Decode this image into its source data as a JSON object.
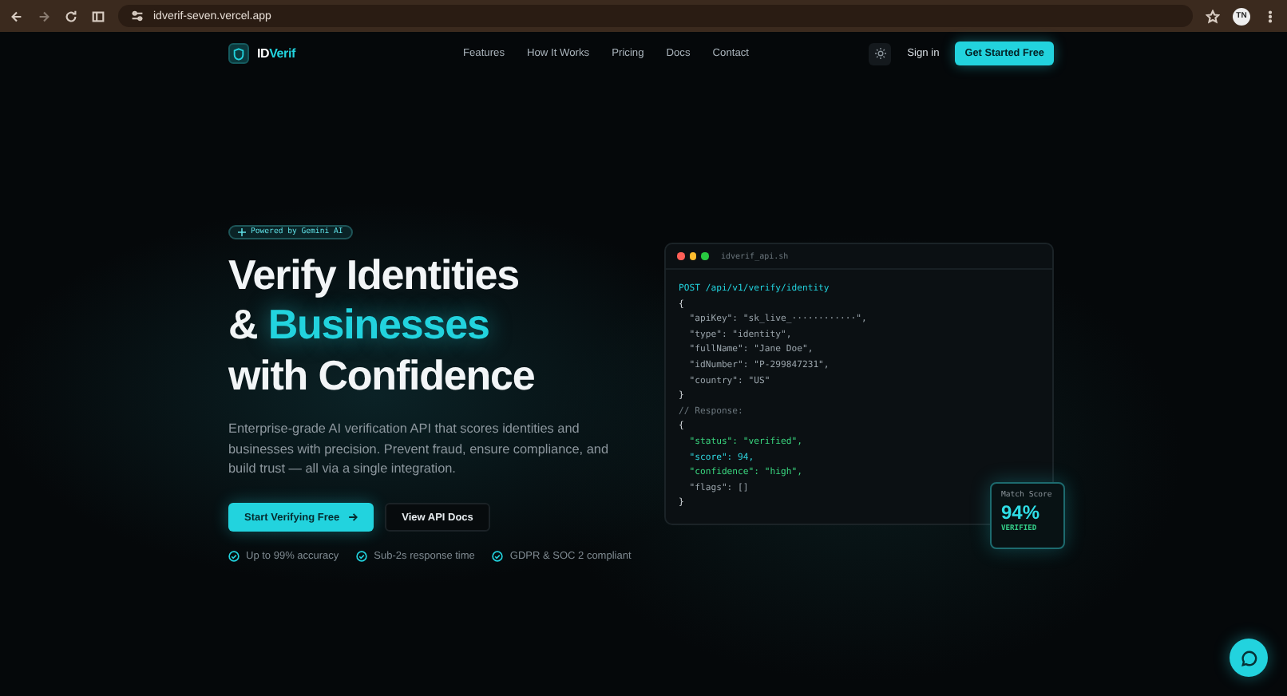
{
  "browser": {
    "url": "idverif-seven.vercel.app",
    "profile": "TN"
  },
  "nav": {
    "brand_prefix": "ID",
    "brand_suffix": "Verif",
    "links": [
      {
        "label": "Features"
      },
      {
        "label": "How It Works"
      },
      {
        "label": "Pricing"
      },
      {
        "label": "Docs"
      },
      {
        "label": "Contact"
      }
    ],
    "sign_in": "Sign in",
    "cta": "Get Started Free"
  },
  "hero": {
    "badge": "Powered by Gemini AI",
    "title_lines": [
      "Verify Identities",
      "& **Businesses**",
      "with Confidence"
    ],
    "description": "Enterprise-grade AI verification API that scores identities and businesses with precision. Prevent fraud, ensure compliance, and build trust — all via a single integration.",
    "primary_button": "Start Verifying Free",
    "secondary_button": "View API Docs",
    "features": [
      "Up to 99% accuracy",
      "Sub-2s response time",
      "GDPR & SOC 2 compliant"
    ]
  },
  "code_window": {
    "filename": "idverif_api.sh",
    "lines": [
      {
        "text": "POST /api/v1/verify/identity",
        "kind": "method"
      },
      {
        "text": "{",
        "kind": "brace"
      },
      {
        "text": "  \"apiKey\": \"sk_live_············\",",
        "kind": "field"
      },
      {
        "text": "  \"type\": \"identity\",",
        "kind": "field"
      },
      {
        "text": "  \"fullName\": \"Jane Doe\",",
        "kind": "field"
      },
      {
        "text": "  \"idNumber\": \"P-299847231\",",
        "kind": "field"
      },
      {
        "text": "  \"country\": \"US\"",
        "kind": "field"
      },
      {
        "text": "}",
        "kind": "brace"
      },
      {
        "text": "// Response:",
        "kind": "comment"
      },
      {
        "text": "{",
        "kind": "brace"
      },
      {
        "text": "  \"status\": \"verified\",",
        "kind": "success"
      },
      {
        "text": "  \"score\": 94,",
        "kind": "accent"
      },
      {
        "text": "  \"confidence\": \"high\",",
        "kind": "success"
      },
      {
        "text": "  \"flags\": []",
        "kind": "field"
      },
      {
        "text": "}",
        "kind": "brace"
      }
    ]
  },
  "score_card": {
    "label": "Match Score",
    "value": "94%",
    "status": "VERIFIED"
  }
}
